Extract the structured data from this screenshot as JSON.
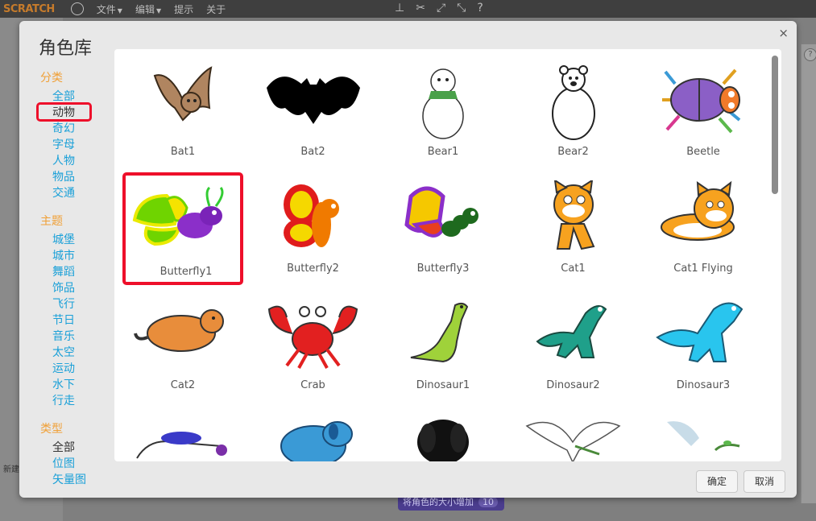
{
  "topbar": {
    "logo": "SCRATCH",
    "menus": [
      "文件",
      "编辑",
      "提示",
      "关于"
    ]
  },
  "background": {
    "block_label": "将角色的大小增加",
    "block_value": "10",
    "left_label": "新建"
  },
  "dialog": {
    "title": "角色库",
    "close": "×",
    "ok": "确定",
    "cancel": "取消"
  },
  "sidebar": {
    "category_head": "分类",
    "categories": [
      "全部",
      "动物",
      "奇幻",
      "字母",
      "人物",
      "物品",
      "交通"
    ],
    "theme_head": "主题",
    "themes": [
      "城堡",
      "城市",
      "舞蹈",
      "饰品",
      "飞行",
      "节日",
      "音乐",
      "太空",
      "运动",
      "水下",
      "行走"
    ],
    "type_head": "类型",
    "types": [
      "全部",
      "位图",
      "矢量图"
    ]
  },
  "sprites": [
    {
      "name": "Bat1",
      "icon": "bat-brown-icon"
    },
    {
      "name": "Bat2",
      "icon": "bat-black-icon"
    },
    {
      "name": "Bear1",
      "icon": "bear-scarf-icon"
    },
    {
      "name": "Bear2",
      "icon": "bear-outline-icon"
    },
    {
      "name": "Beetle",
      "icon": "beetle-icon"
    },
    {
      "name": "Butterfly1",
      "icon": "butterfly-green-icon"
    },
    {
      "name": "Butterfly2",
      "icon": "butterfly-red-icon"
    },
    {
      "name": "Butterfly3",
      "icon": "butterfly-purple-icon"
    },
    {
      "name": "Cat1",
      "icon": "cat-icon"
    },
    {
      "name": "Cat1 Flying",
      "icon": "cat-flying-icon"
    },
    {
      "name": "Cat2",
      "icon": "cat2-icon"
    },
    {
      "name": "Crab",
      "icon": "crab-icon"
    },
    {
      "name": "Dinosaur1",
      "icon": "dinosaur-green-icon"
    },
    {
      "name": "Dinosaur2",
      "icon": "dinosaur-teal-icon"
    },
    {
      "name": "Dinosaur3",
      "icon": "dinosaur-blue-icon"
    },
    {
      "name": "",
      "icon": "dragonfly-icon"
    },
    {
      "name": "",
      "icon": "dog-blue-icon"
    },
    {
      "name": "",
      "icon": "puppy-photo-icon"
    },
    {
      "name": "",
      "icon": "dove-icon"
    },
    {
      "name": "",
      "icon": "bird-branch-icon"
    }
  ],
  "selected_sprite": "Butterfly1",
  "colors": {
    "accent": "#1aa0d8",
    "head": "#f0a037",
    "highlight": "#ee0f2a"
  }
}
